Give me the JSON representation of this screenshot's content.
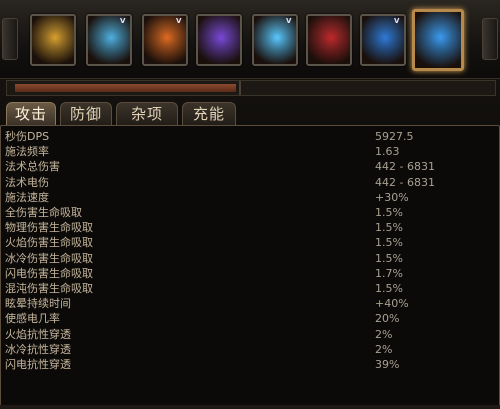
{
  "skills": [
    {
      "icon": "sword-skill-icon",
      "color": "#d9a02e",
      "has_badge": false
    },
    {
      "icon": "lightning-figure-skill-icon",
      "color": "#4fb0e0",
      "has_badge": true
    },
    {
      "icon": "fire-warrior-skill-icon",
      "color": "#e06a20",
      "has_badge": true
    },
    {
      "icon": "purple-bolt-skill-icon",
      "color": "#7a48d8",
      "has_badge": false
    },
    {
      "icon": "ice-blade-skill-icon",
      "color": "#5ac8ff",
      "has_badge": true
    },
    {
      "icon": "red-demon-skill-icon",
      "color": "#c0282a",
      "has_badge": false
    },
    {
      "icon": "blue-spirit-skill-icon",
      "color": "#2f7ad8",
      "has_badge": true
    },
    {
      "icon": "storm-arc-skill-icon",
      "color": "#3a9af0",
      "has_badge": false
    }
  ],
  "skill_badge": "V",
  "progress_fraction": 0.46,
  "tabs": [
    {
      "label": "攻击",
      "active": true
    },
    {
      "label": "防御",
      "active": false
    },
    {
      "label": "杂项",
      "active": false
    },
    {
      "label": "充能",
      "active": false
    }
  ],
  "stats": [
    {
      "label": "秒伤DPS",
      "value": "5927.5"
    },
    {
      "label": "施法频率",
      "value": "1.63"
    },
    {
      "label": "法术总伤害",
      "value": "442 - 6831"
    },
    {
      "label": "法术电伤",
      "value": "442 - 6831"
    },
    {
      "label": "施法速度",
      "value": "+30%"
    },
    {
      "label": "全伤害生命吸取",
      "value": "1.5%"
    },
    {
      "label": "物理伤害生命吸取",
      "value": "1.5%"
    },
    {
      "label": "火焰伤害生命吸取",
      "value": "1.5%"
    },
    {
      "label": "冰冷伤害生命吸取",
      "value": "1.5%"
    },
    {
      "label": "闪电伤害生命吸取",
      "value": "1.7%"
    },
    {
      "label": "混沌伤害生命吸取",
      "value": "1.5%"
    },
    {
      "label": "眩晕持续时间",
      "value": "+40%"
    },
    {
      "label": "使感电几率",
      "value": "20%"
    },
    {
      "label": "火焰抗性穿透",
      "value": "2%"
    },
    {
      "label": "冰冷抗性穿透",
      "value": "2%"
    },
    {
      "label": "闪电抗性穿透",
      "value": "39%"
    }
  ]
}
